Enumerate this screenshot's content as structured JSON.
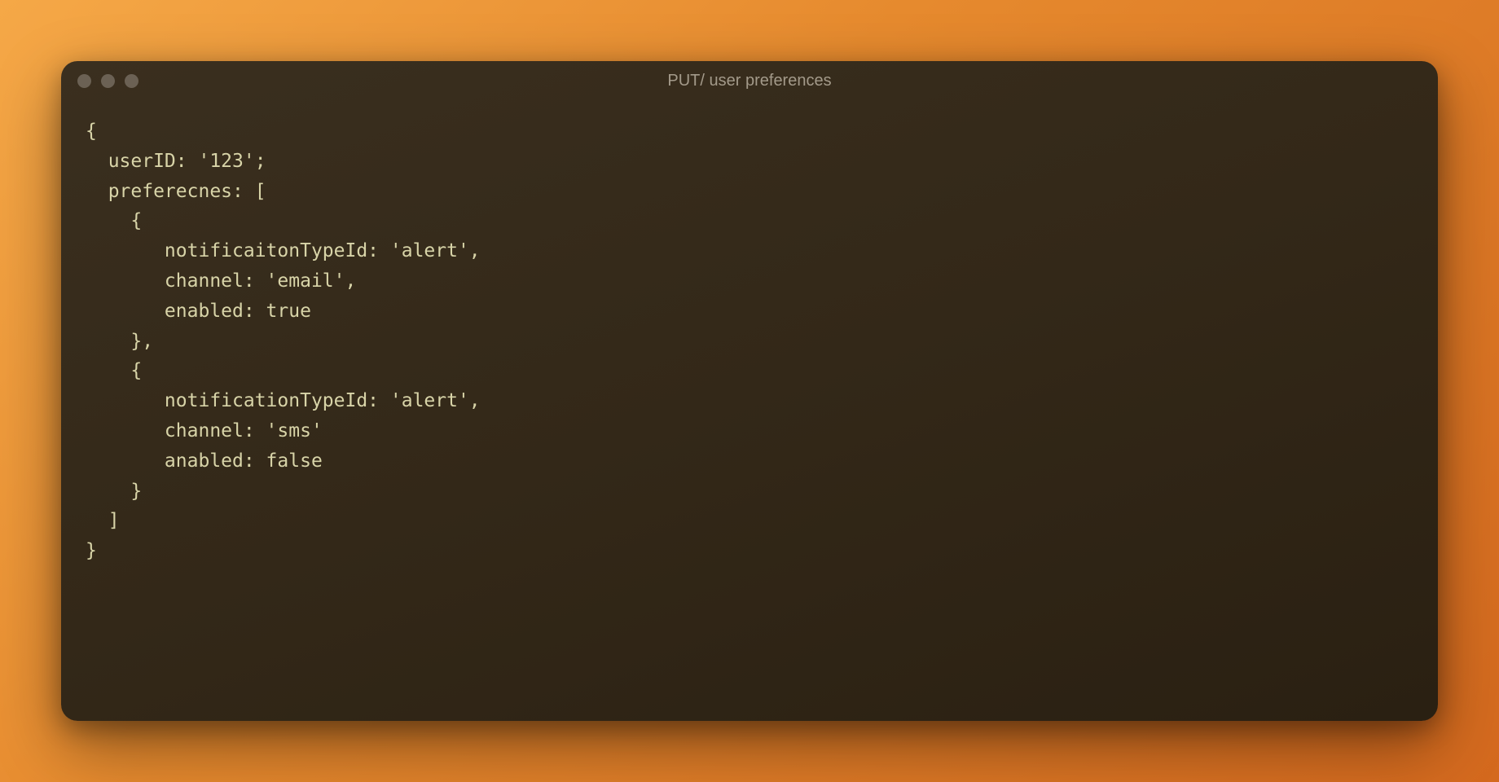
{
  "window": {
    "title": "PUT/ user preferences"
  },
  "code": {
    "line1": "{",
    "line2": "  userID: '123';",
    "line3": "  preferecnes: [",
    "line4": "    {",
    "line5": "       notificaitonTypeId: 'alert',",
    "line6": "       channel: 'email',",
    "line7": "       enabled: true",
    "line8": "    },",
    "line9": "    {",
    "line10": "       notificationTypeId: 'alert',",
    "line11": "       channel: 'sms'",
    "line12": "       anabled: false",
    "line13": "    }",
    "line14": "  ]",
    "line15": "}"
  }
}
